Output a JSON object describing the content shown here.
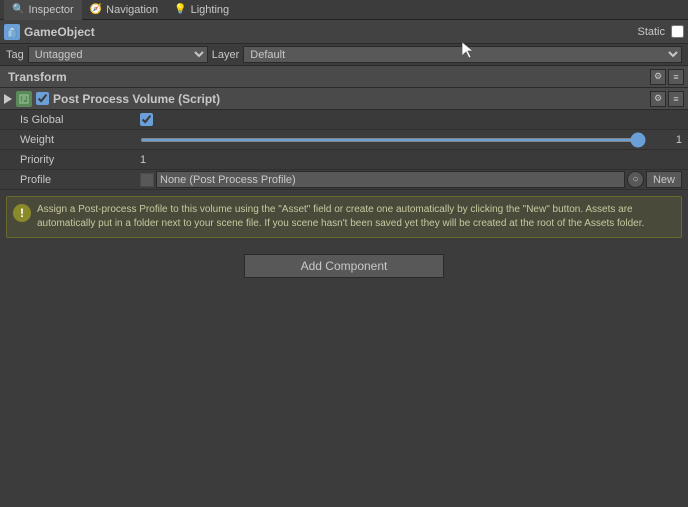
{
  "tabs": [
    {
      "id": "inspector",
      "label": "Inspector",
      "active": true
    },
    {
      "id": "navigation",
      "label": "Navigation",
      "active": false
    },
    {
      "id": "lighting",
      "label": "Lighting",
      "active": false
    }
  ],
  "header": {
    "gameobject_name": "GameObject",
    "static_label": "Static"
  },
  "tag_row": {
    "tag_label": "Tag",
    "tag_value": "Untagged",
    "layer_label": "Layer",
    "layer_value": "Default"
  },
  "transform_section": {
    "title": "Transform"
  },
  "post_process_section": {
    "title": "Post Process Volume (Script)",
    "is_global_label": "Is Global",
    "weight_label": "Weight",
    "weight_value": "1",
    "weight_slider_value": 1,
    "priority_label": "Priority",
    "priority_value": "1",
    "profile_label": "Profile",
    "profile_value": "None (Post Process Profile)",
    "new_button_label": "New"
  },
  "info_box": {
    "icon": "!",
    "text": "Assign a Post-process Profile to this volume using the \"Asset\" field or create one automatically by clicking the \"New\" button. Assets are automatically put in a folder next to your scene file. If you scene hasn't been saved yet they will be created at the root of the Assets folder."
  },
  "add_component": {
    "button_label": "Add Component"
  }
}
